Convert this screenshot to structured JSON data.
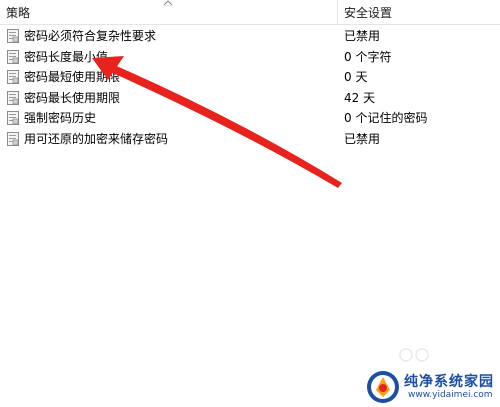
{
  "columns": {
    "policy": "策略",
    "setting": "安全设置"
  },
  "rows": [
    {
      "name": "密码必须符合复杂性要求",
      "value": "已禁用"
    },
    {
      "name": "密码长度最小值",
      "value": "0 个字符"
    },
    {
      "name": "密码最短使用期限",
      "value": "0 天"
    },
    {
      "name": "密码最长使用期限",
      "value": "42 天"
    },
    {
      "name": "强制密码历史",
      "value": "0 个记住的密码"
    },
    {
      "name": "用可还原的加密来储存密码",
      "value": "已禁用"
    }
  ],
  "icons": {
    "policy": "policy-document-icon",
    "sort": "sort-ascending-icon",
    "annotation": "red-arrow-annotation"
  },
  "colors": {
    "annotation": "#e8231d",
    "watermark": "#1c4fa3"
  },
  "watermark": {
    "title": "纯净系统家园",
    "url": "www.yidaimei.com"
  }
}
